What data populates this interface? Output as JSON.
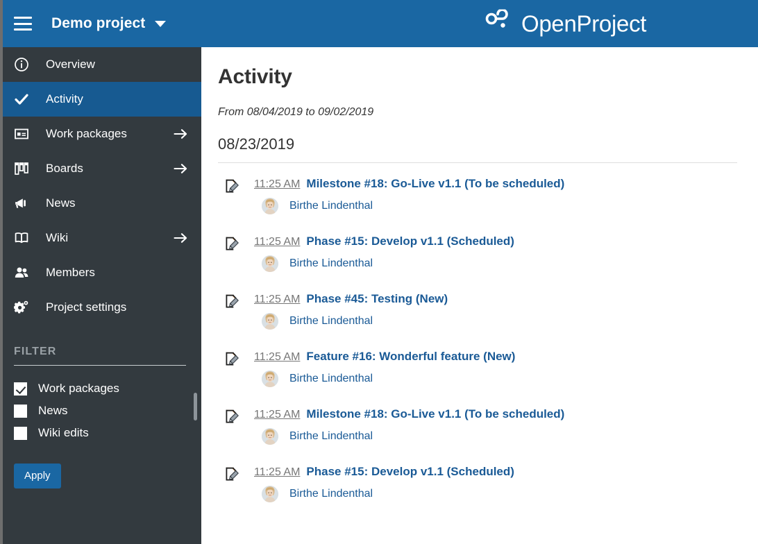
{
  "colors": {
    "topbar": "#1a67a3",
    "sidebar": "#333a3f",
    "sidebar_active": "#175a91",
    "accent_link": "#1a5a96",
    "button": "#1a67a3",
    "muted_text": "#767676",
    "filter_title": "#9aa1a6"
  },
  "topbar": {
    "menu_icon": "hamburger-icon",
    "project_name": "Demo project",
    "project_dropdown_icon": "chevron-down-icon",
    "brand_logo_icon": "openproject-logo-icon",
    "brand_name": "OpenProject"
  },
  "sidebar": {
    "items": [
      {
        "label": "Overview",
        "icon": "info-circle-icon",
        "active": false,
        "has_arrow": false
      },
      {
        "label": "Activity",
        "icon": "check-icon",
        "active": true,
        "has_arrow": false
      },
      {
        "label": "Work packages",
        "icon": "work-package-icon",
        "active": false,
        "has_arrow": true
      },
      {
        "label": "Boards",
        "icon": "boards-icon",
        "active": false,
        "has_arrow": true
      },
      {
        "label": "News",
        "icon": "megaphone-icon",
        "active": false,
        "has_arrow": false
      },
      {
        "label": "Wiki",
        "icon": "book-icon",
        "active": false,
        "has_arrow": true
      },
      {
        "label": "Members",
        "icon": "people-icon",
        "active": false,
        "has_arrow": false
      },
      {
        "label": "Project settings",
        "icon": "gear-icon",
        "active": false,
        "has_arrow": false
      }
    ],
    "filter": {
      "title": "FILTER",
      "options": [
        {
          "label": "Work packages",
          "checked": true
        },
        {
          "label": "News",
          "checked": false
        },
        {
          "label": "Wiki edits",
          "checked": false
        }
      ],
      "apply_label": "Apply"
    }
  },
  "main": {
    "title": "Activity",
    "date_range": "From 08/04/2019 to 09/02/2019",
    "day_heading": "08/23/2019",
    "activities": [
      {
        "icon": "edit-document-icon",
        "time": "11:25 AM",
        "title": "Milestone #18: Go-Live v1.1 (To be scheduled)",
        "user": "Birthe Lindenthal",
        "avatar": "user-photo-avatar"
      },
      {
        "icon": "edit-document-icon",
        "time": "11:25 AM",
        "title": "Phase #15: Develop v1.1 (Scheduled)",
        "user": "Birthe Lindenthal",
        "avatar": "user-photo-avatar"
      },
      {
        "icon": "edit-document-icon",
        "time": "11:25 AM",
        "title": "Phase #45: Testing (New)",
        "user": "Birthe Lindenthal",
        "avatar": "user-photo-avatar"
      },
      {
        "icon": "edit-document-icon",
        "time": "11:25 AM",
        "title": "Feature #16: Wonderful feature (New)",
        "user": "Birthe Lindenthal",
        "avatar": "user-photo-avatar"
      },
      {
        "icon": "edit-document-icon",
        "time": "11:25 AM",
        "title": "Milestone #18: Go-Live v1.1 (To be scheduled)",
        "user": "Birthe Lindenthal",
        "avatar": "user-photo-avatar"
      },
      {
        "icon": "edit-document-icon",
        "time": "11:25 AM",
        "title": "Phase #15: Develop v1.1 (Scheduled)",
        "user": "Birthe Lindenthal",
        "avatar": "user-photo-avatar"
      }
    ]
  }
}
